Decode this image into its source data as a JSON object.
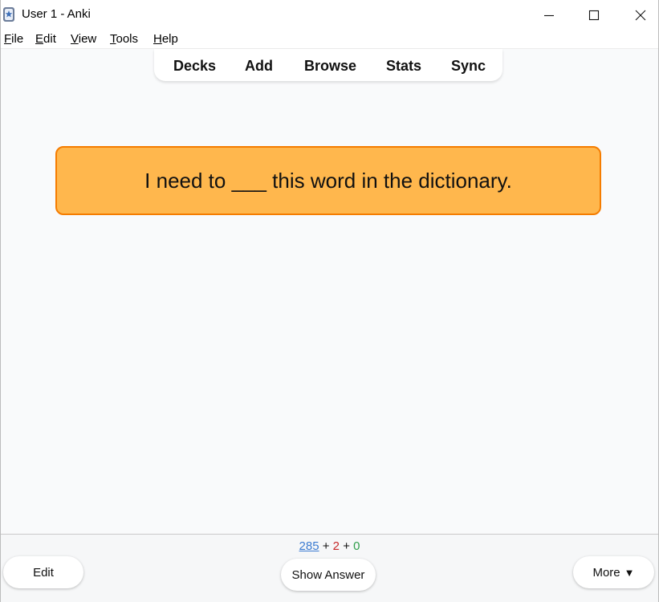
{
  "window": {
    "title": "User 1 - Anki"
  },
  "menu": {
    "items": [
      {
        "accel": "F",
        "rest": "ile"
      },
      {
        "accel": "E",
        "rest": "dit"
      },
      {
        "accel": "V",
        "rest": "iew"
      },
      {
        "accel": "T",
        "rest": "ools"
      },
      {
        "accel": "H",
        "rest": "elp"
      }
    ]
  },
  "toolbar": {
    "decks": "Decks",
    "add": "Add",
    "browse": "Browse",
    "stats": "Stats",
    "sync": "Sync"
  },
  "card": {
    "question": "I need to ___ this word in the dictionary."
  },
  "counts": {
    "new": "285",
    "learn": "2",
    "review": "0",
    "plus": "+"
  },
  "bottom": {
    "edit_label": "Edit",
    "show_answer_label": "Show Answer",
    "more_label": "More",
    "more_arrow": "▼"
  },
  "colors": {
    "card_bg": "#ffb74d",
    "card_border": "#f57c00",
    "new_count": "#3b7bd1",
    "learn_count": "#c62828",
    "review_count": "#2e9d4a"
  }
}
